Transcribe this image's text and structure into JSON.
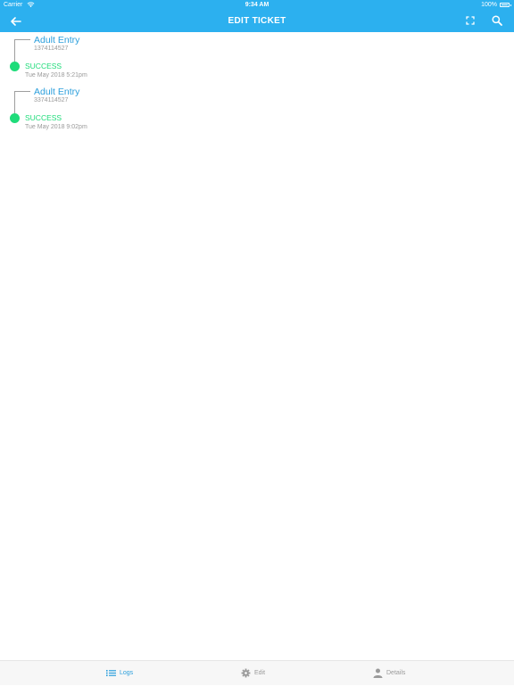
{
  "status_bar": {
    "carrier": "Carrier",
    "time": "9:34 AM",
    "battery": "100%"
  },
  "header": {
    "title": "EDIT TICKET",
    "back_icon": "arrow-left-icon",
    "expand_icon": "expand-icon",
    "search_icon": "search-icon",
    "color": "#2cb0ef"
  },
  "logs": [
    {
      "title": "Adult Entry",
      "code": "1374114527",
      "status": "SUCCESS",
      "time": "Tue May 2018 5:21pm"
    },
    {
      "title": "Adult Entry",
      "code": "3374114527",
      "status": "SUCCESS",
      "time": "Tue May 2018 9:02pm"
    }
  ],
  "tabs": [
    {
      "label": "Logs",
      "icon": "list-icon",
      "active": true
    },
    {
      "label": "Edit",
      "icon": "gear-icon",
      "active": false
    },
    {
      "label": "Details",
      "icon": "person-icon",
      "active": false
    }
  ],
  "colors": {
    "accent": "#2c9fdc",
    "success": "#1fdc7a",
    "muted": "#9a9a9a"
  }
}
